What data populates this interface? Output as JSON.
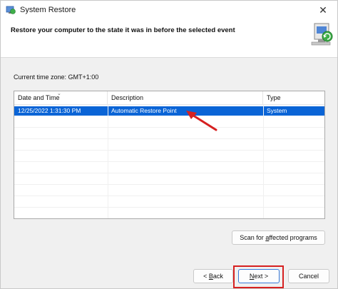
{
  "window": {
    "title": "System Restore",
    "close_glyph": "✕"
  },
  "header": {
    "text": "Restore your computer to the state it was in before the selected event",
    "icon": "system-restore-icon"
  },
  "timezone_label": "Current time zone: GMT+1:00",
  "list": {
    "columns": [
      "Date and Time",
      "Description",
      "Type"
    ],
    "rows": [
      {
        "date": "12/25/2022 1:31:30 PM",
        "description": "Automatic Restore Point",
        "type": "System",
        "selected": true
      }
    ]
  },
  "buttons": {
    "scan_pre": "Scan for ",
    "scan_u": "a",
    "scan_post": "ffected programs",
    "back_pre": "< ",
    "back_u": "B",
    "back_post": "ack",
    "next_u": "N",
    "next_post": "ext >",
    "cancel": "Cancel"
  },
  "colors": {
    "selection": "#0a64d6",
    "annotation": "#d62020"
  }
}
